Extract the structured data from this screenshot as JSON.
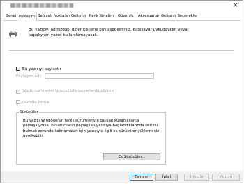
{
  "tabs": [
    {
      "label": "Genel",
      "active": false
    },
    {
      "label": "Paylaşım",
      "active": true
    },
    {
      "label": "Bağlantı Noktaları",
      "active": false
    },
    {
      "label": "Gelişmiş",
      "active": false
    },
    {
      "label": "Renk Yönetimi",
      "active": false
    },
    {
      "label": "Güvenlik",
      "active": false
    },
    {
      "label": "Aksesuarlar",
      "active": false
    },
    {
      "label": "Gelişmiş Seçenekler",
      "active": false
    }
  ],
  "intro_text": "Bu yazıcıyı ağınızdaki diğer kişilerle paylaşabilirsiniz. Bilgisayar uykudayken veya kapalıyken yazıcı kullanılamayacak.",
  "share_printer": {
    "label": "Bu yazıcıyı paylaştır",
    "checked": false
  },
  "share_name": {
    "label": "Paylaşım adı:",
    "value": ""
  },
  "render_jobs": {
    "label": "Yazdırma işlerini istemci bilgisayarlarda oluştur",
    "checked": true,
    "enabled": false
  },
  "list_in_directory": {
    "label": "Dizinde listele",
    "checked": false,
    "enabled": false
  },
  "drivers": {
    "title": "Sürücüler",
    "text": "Bu yazıcı Windows'un farklı sürümleriyle çalışan kullanıcılarca paylaşılıyorsa, kullanıcıların paylaşılan yazıcıya bağlandıklarında sürücü bulmak zorunda kalmamaları için yazıcıyla ilgili ek sürücüler yüklemeniz gerekebilir.",
    "button": "Ek Sürücüler..."
  },
  "footer": {
    "ok": "Tamam",
    "cancel": "İptal",
    "apply": "Uygula",
    "help": "Yardım"
  }
}
